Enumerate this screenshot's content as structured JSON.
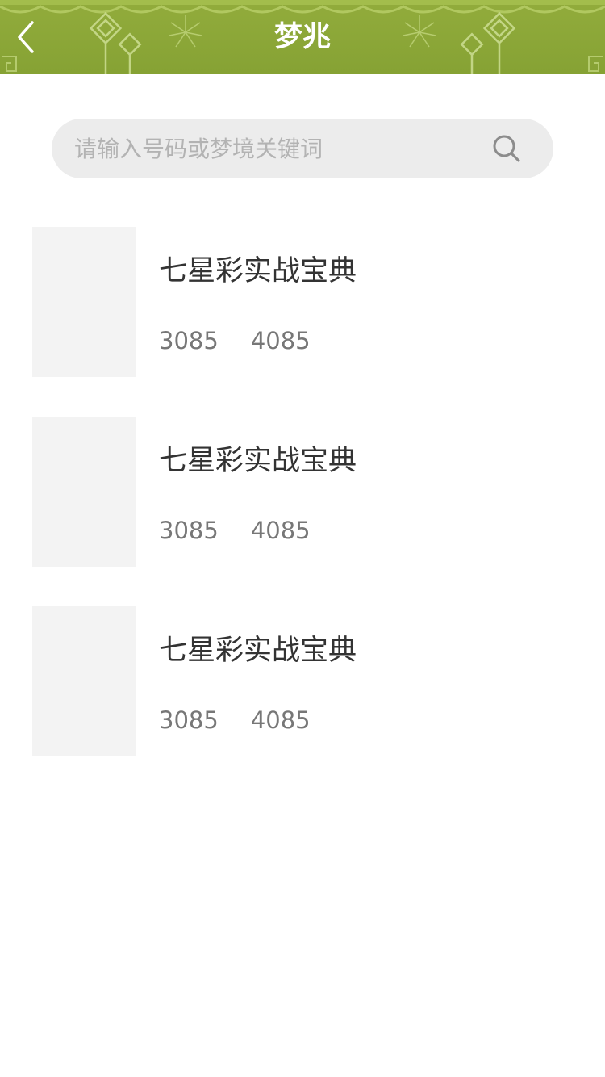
{
  "header": {
    "title": "梦兆",
    "back_icon": "chevron-left-icon",
    "color": "#8aa637"
  },
  "search": {
    "placeholder": "请输入号码或梦境关键词",
    "value": "",
    "icon": "search-icon"
  },
  "items": [
    {
      "title": "七星彩实战宝典",
      "numbers": [
        "3085",
        "4085"
      ]
    },
    {
      "title": "七星彩实战宝典",
      "numbers": [
        "3085",
        "4085"
      ]
    },
    {
      "title": "七星彩实战宝典",
      "numbers": [
        "3085",
        "4085"
      ]
    }
  ]
}
